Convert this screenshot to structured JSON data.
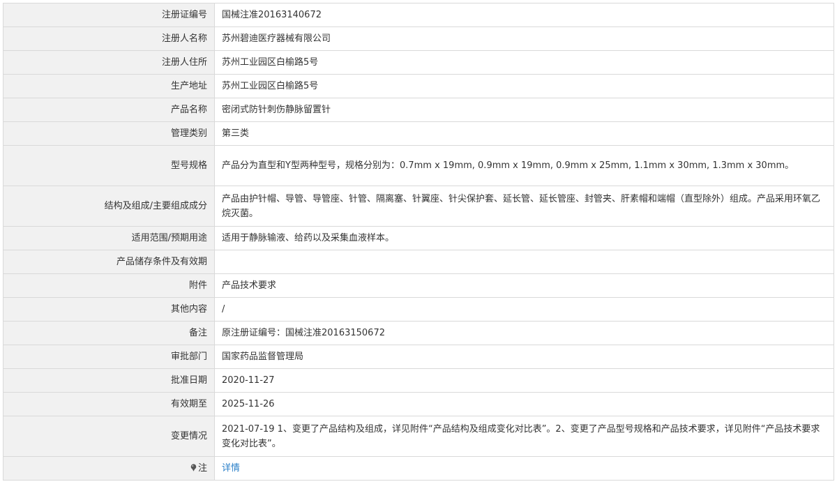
{
  "rows": [
    {
      "label": "注册证编号",
      "value": "国械注准20163140672"
    },
    {
      "label": "注册人名称",
      "value": "苏州碧迪医疗器械有限公司"
    },
    {
      "label": "注册人住所",
      "value": "苏州工业园区白榆路5号"
    },
    {
      "label": "生产地址",
      "value": "苏州工业园区白榆路5号"
    },
    {
      "label": "产品名称",
      "value": "密闭式防针刺伤静脉留置针"
    },
    {
      "label": "管理类别",
      "value": "第三类"
    },
    {
      "label": "型号规格",
      "value": "产品分为直型和Y型两种型号，规格分别为：0.7mm x 19mm, 0.9mm x 19mm, 0.9mm x 25mm, 1.1mm x 30mm, 1.3mm x 30mm。"
    },
    {
      "label": "结构及组成/主要组成成分",
      "value": "产品由护针帽、导管、导管座、针管、隔离塞、针翼座、针尖保护套、延长管、延长管座、封管夹、肝素帽和端帽（直型除外）组成。产品采用环氧乙烷灭菌。"
    },
    {
      "label": "适用范围/预期用途",
      "value": "适用于静脉输液、给药以及采集血液样本。"
    },
    {
      "label": "产品储存条件及有效期",
      "value": ""
    },
    {
      "label": "附件",
      "value": "产品技术要求"
    },
    {
      "label": "其他内容",
      "value": "/"
    },
    {
      "label": "备注",
      "value": "原注册证编号：国械注准20163150672"
    },
    {
      "label": "审批部门",
      "value": "国家药品监督管理局"
    },
    {
      "label": "批准日期",
      "value": "2020-11-27"
    },
    {
      "label": "有效期至",
      "value": "2025-11-26"
    },
    {
      "label": "变更情况",
      "value": "2021-07-19 1、变更了产品结构及组成，详见附件“产品结构及组成变化对比表”。2、变更了产品型号规格和产品技术要求，详见附件“产品技术要求变化对比表”。"
    }
  ],
  "note": {
    "label": "注",
    "icon": "pin-icon",
    "link_text": "详情",
    "link_color": "#2a7fc8"
  }
}
